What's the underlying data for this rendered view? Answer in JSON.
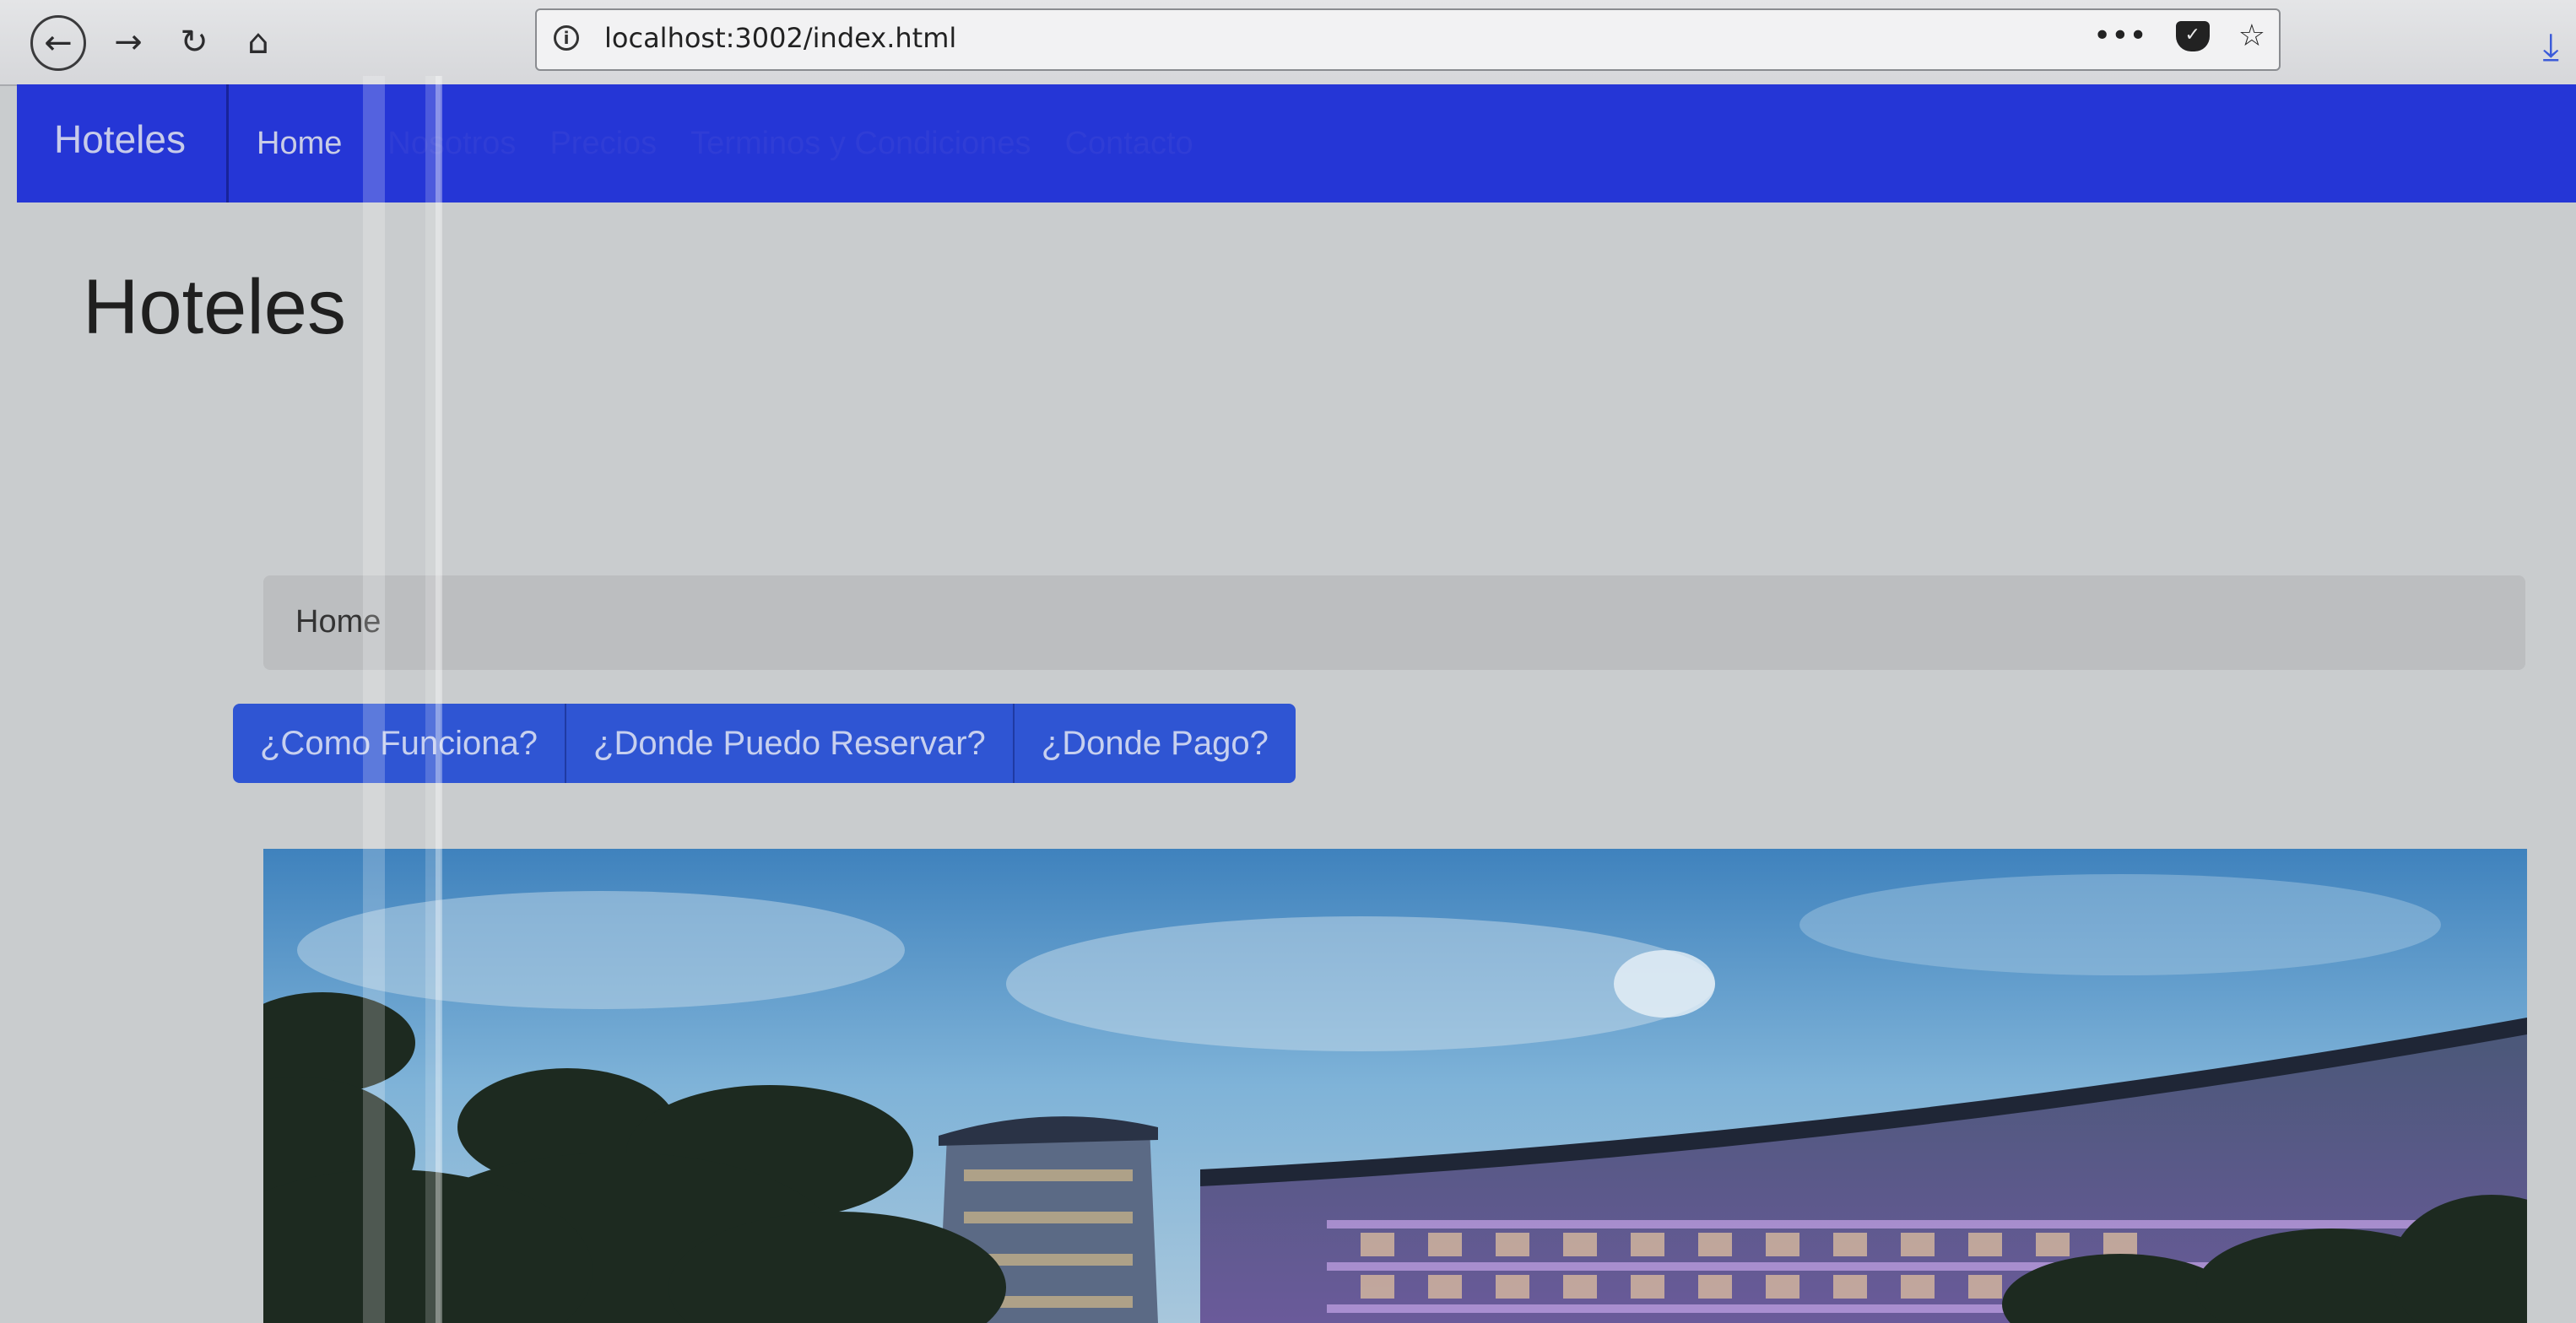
{
  "browser": {
    "url": "localhost:3002/index.html",
    "icons": {
      "back": "arrow-left-icon",
      "forward": "arrow-right-icon",
      "reload": "reload-icon",
      "home": "home-icon",
      "info": "info-icon",
      "menu": "more-dots-icon",
      "pocket": "pocket-icon",
      "bookmark": "star-icon",
      "download": "download-icon"
    }
  },
  "navbar": {
    "brand": "Hoteles",
    "links": [
      "Home",
      "Nosotros",
      "Precios",
      "Terminos y Condiciones",
      "Contacto"
    ],
    "active_link": "Home",
    "color": "#2536d6"
  },
  "page": {
    "title": "Hoteles",
    "breadcrumb": [
      "Home"
    ],
    "buttons": [
      "¿Como Funciona?",
      "¿Donde Puedo Reservar?",
      "¿Donde Pago?"
    ],
    "button_color": "#2f55d3"
  },
  "hero": {
    "image": "hotel-building-with-palm-trees"
  }
}
